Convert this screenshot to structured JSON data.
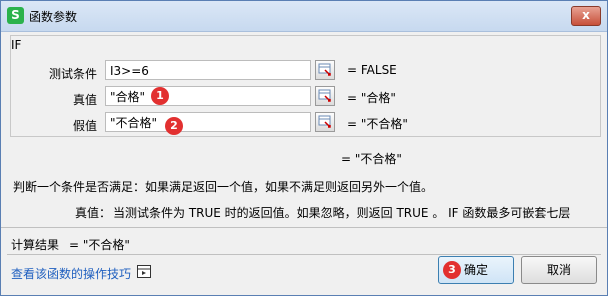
{
  "window": {
    "title": "函数参数",
    "app_icon_letter": "S",
    "close_label": "x"
  },
  "group": {
    "label": "IF"
  },
  "args": [
    {
      "label": "测试条件",
      "value": "I3>=6",
      "result": "=  FALSE"
    },
    {
      "label": "真值",
      "value": "\"合格\"",
      "result": "=  \"合格\"",
      "badge": "1"
    },
    {
      "label": "假值",
      "value": "\"不合格\"",
      "result": "=  \"不合格\"",
      "badge": "2"
    }
  ],
  "formula_result": "=  \"不合格\"",
  "description": "判断一个条件是否满足：如果满足返回一个值，如果不满足则返回另外一个值。",
  "arg_help": {
    "name": "真值：",
    "text": "当测试条件为 TRUE 时的返回值。如果忽略，则返回 TRUE 。 IF 函数最多可嵌套七层"
  },
  "calc_result": {
    "label": "计算结果",
    "value": "=  \"不合格\""
  },
  "help_link": "查看该函数的操作技巧",
  "buttons": {
    "ok": "确定",
    "cancel": "取消",
    "ok_badge": "3"
  }
}
